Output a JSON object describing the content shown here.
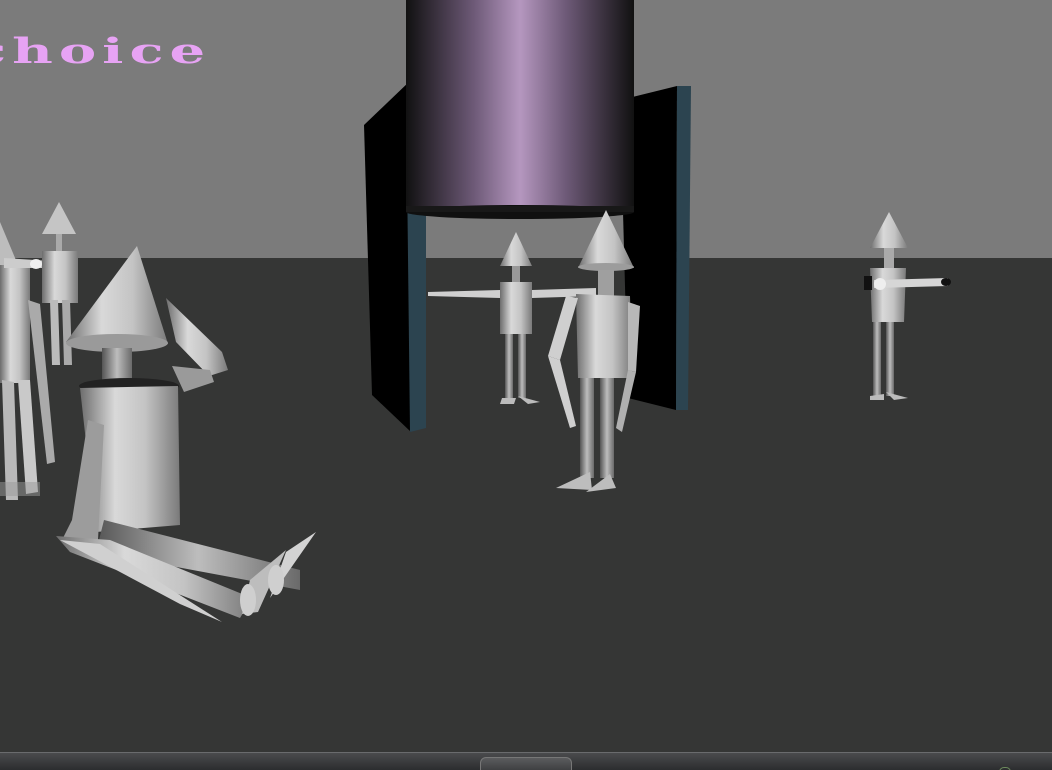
{
  "scene": {
    "floating_text": "choice",
    "colors": {
      "sky": "#7b7b7b",
      "ground": "#353635",
      "text": "#e7a3f4",
      "pillar_top": "#b597bf",
      "panel": "#000000",
      "panel_edge": "#2c4450",
      "figure": "#c4c4c4"
    },
    "objects": [
      "purple-cylinder-pillar",
      "dark-panel-left",
      "dark-panel-right",
      "seated-figure",
      "standing-figures"
    ]
  }
}
